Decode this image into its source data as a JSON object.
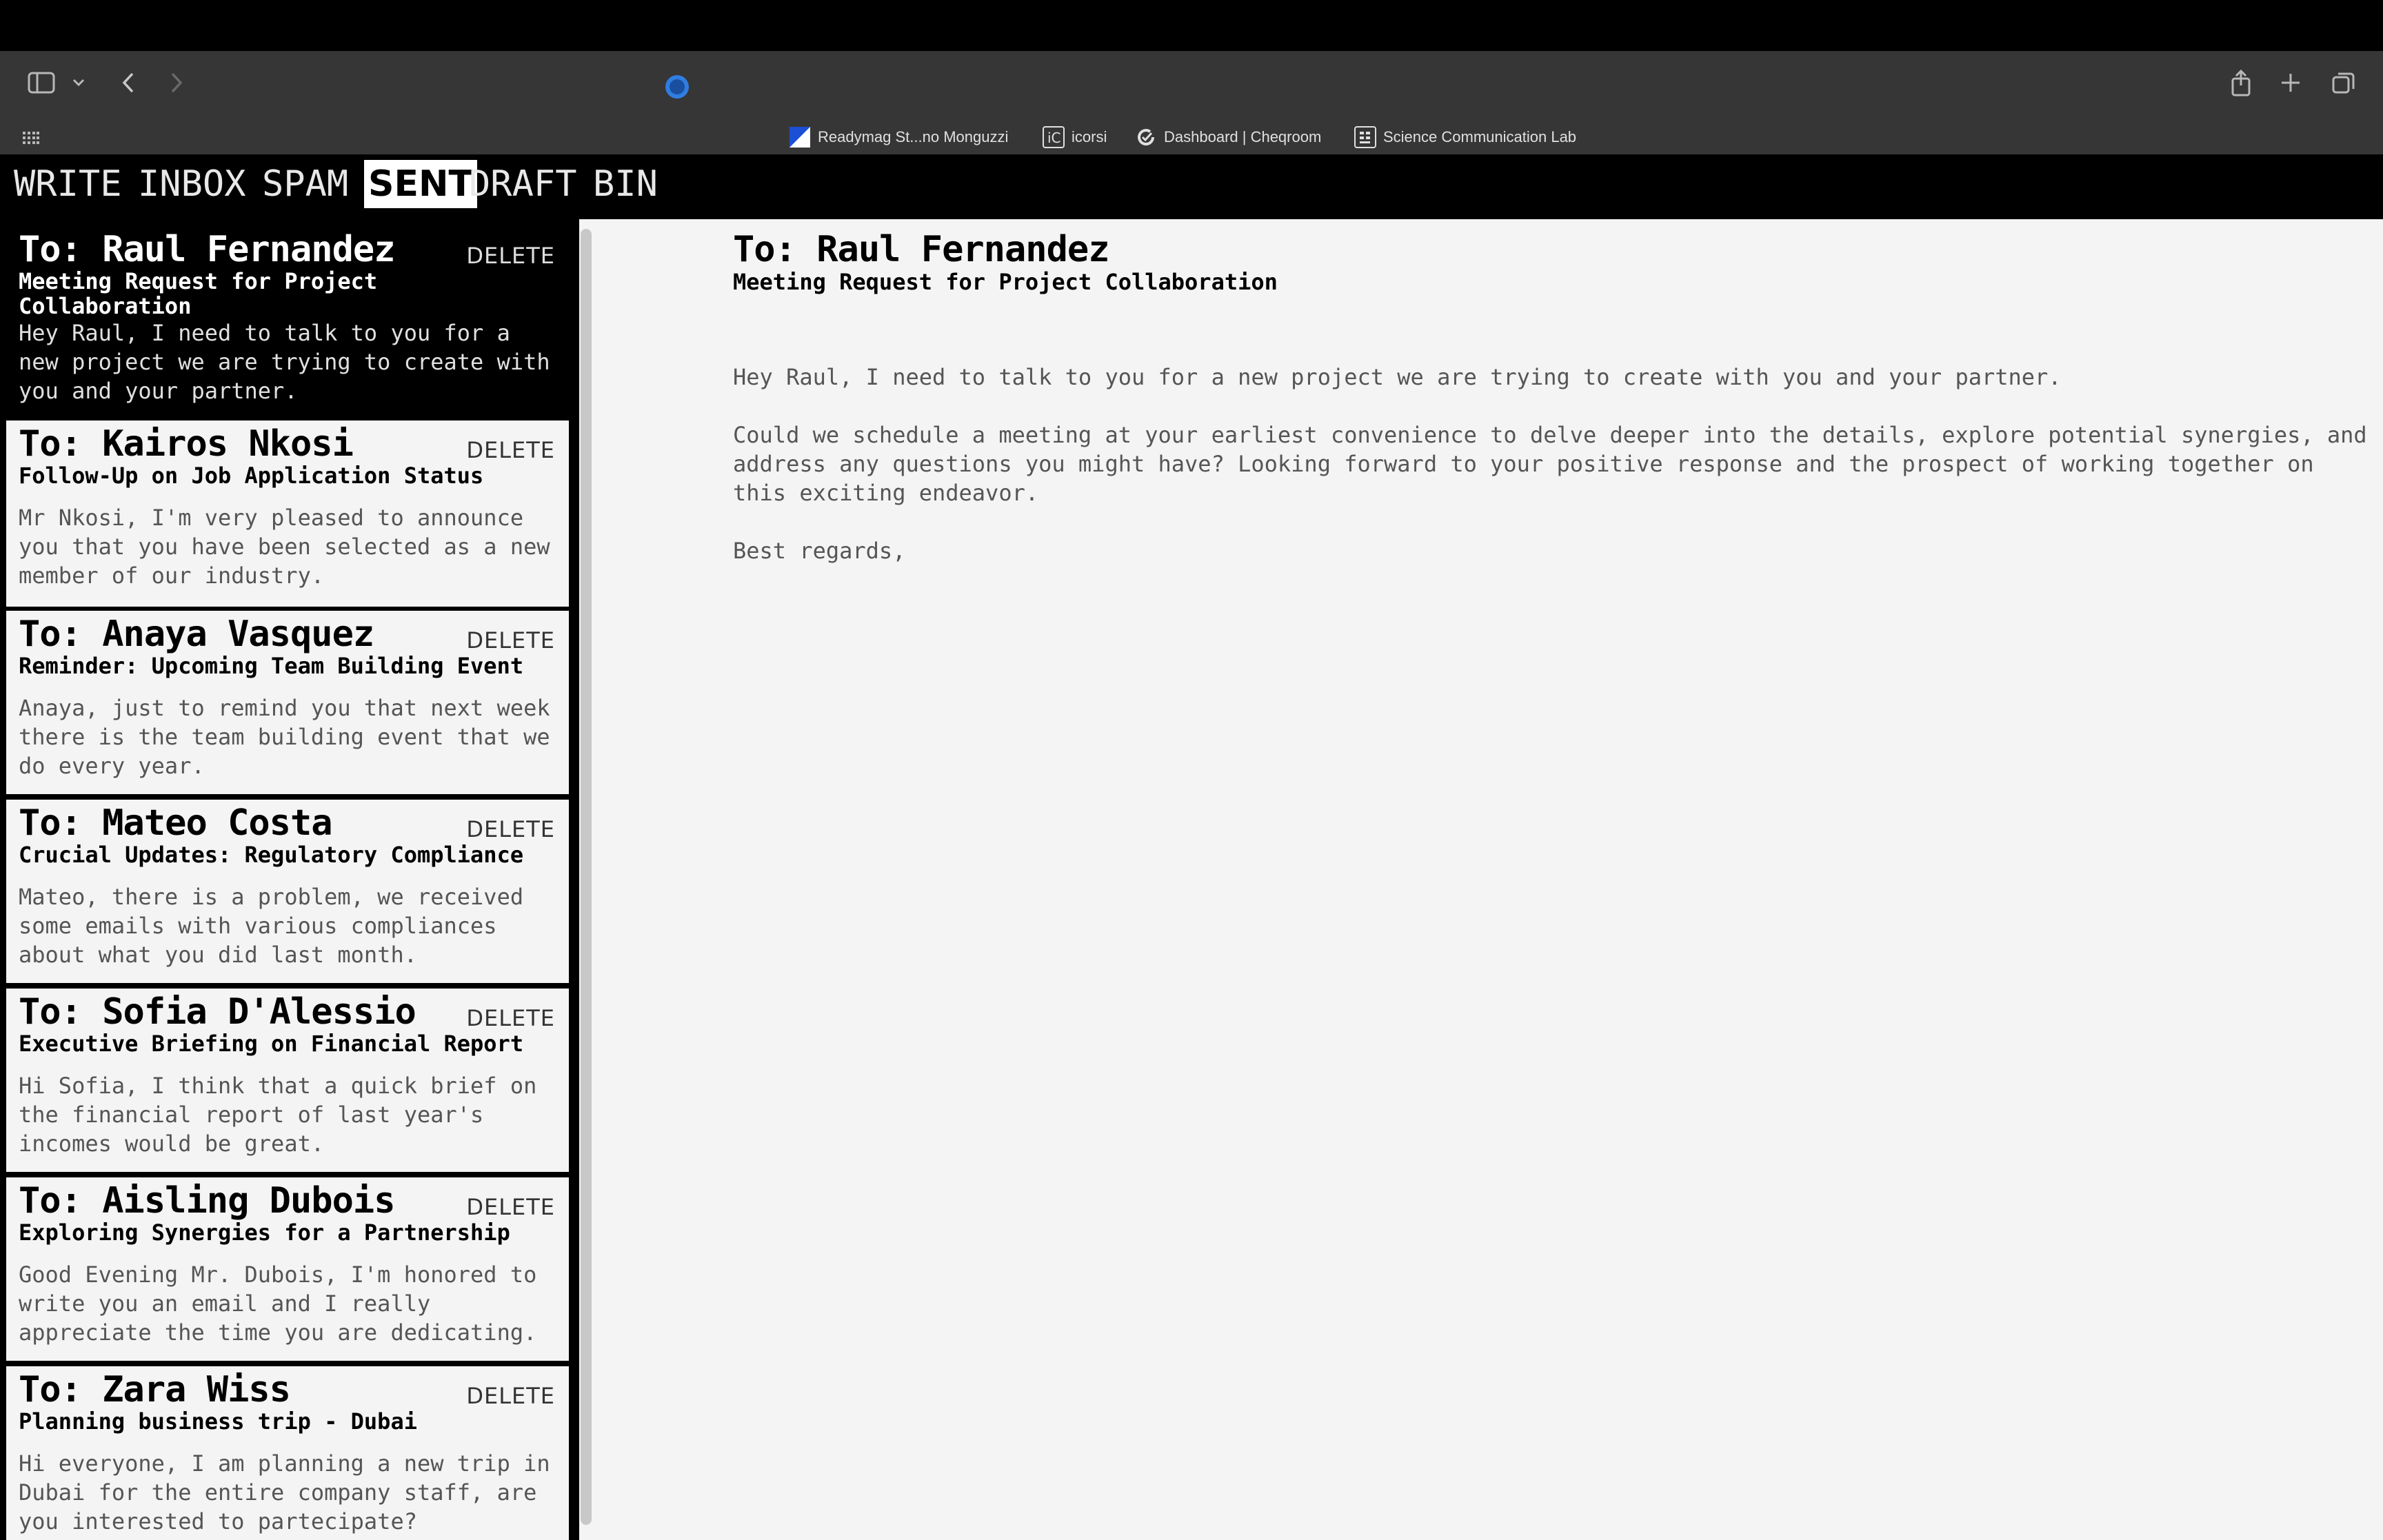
{
  "browser": {
    "url": "localhost",
    "bookmarks": [
      {
        "label": "Readymag St...no Monguzzi",
        "icon": "readymag-favicon"
      },
      {
        "label": "icorsi",
        "icon": "icorsi-favicon"
      },
      {
        "label": "Dashboard | Cheqroom",
        "icon": "cheqroom-favicon"
      },
      {
        "label": "Science Communication Lab",
        "icon": "scl-favicon"
      }
    ]
  },
  "nav": {
    "write": "WRITE",
    "inbox": "INBOX",
    "spam": "SPAM",
    "sent": "SENT",
    "draft": "DRAFT",
    "bin": "BIN",
    "active": "SENT"
  },
  "emails": [
    {
      "to": "To: Raul Fernandez",
      "subject": "Meeting Request for Project Collaboration",
      "preview": "Hey Raul, I need to talk to you for a new project we are trying to create with you and your partner.",
      "delete_label": "DELETE",
      "selected": true
    },
    {
      "to": "To: Kairos Nkosi",
      "subject": "Follow-Up on Job Application Status",
      "preview": "Mr Nkosi, I'm very pleased to announce you that you have been selected as a new member of our industry.",
      "delete_label": "DELETE"
    },
    {
      "to": "To: Anaya Vasquez",
      "subject": "Reminder: Upcoming Team Building Event",
      "preview": "Anaya, just to remind you that next week there is the team building event that we do every year.",
      "delete_label": "DELETE"
    },
    {
      "to": "To: Mateo Costa",
      "subject": "Crucial Updates: Regulatory Compliance",
      "preview": "Mateo, there is a problem, we received some emails with various compliances about what you did last month.",
      "delete_label": "DELETE"
    },
    {
      "to": "To: Sofia D'Alessio",
      "subject": "Executive Briefing on Financial Report",
      "preview": "Hi Sofia, I think that a quick brief on the financial report of last year's incomes would be great.",
      "delete_label": "DELETE"
    },
    {
      "to": "To: Aisling Dubois",
      "subject": "Exploring Synergies for a Partnership",
      "preview": "Good Evening Mr. Dubois, I'm honored to write you an email and I really appreciate the time you are dedicating.",
      "delete_label": "DELETE"
    },
    {
      "to": "To: Zara Wiss",
      "subject": "Planning business trip - Dubai",
      "preview": "Hi everyone, I am planning a new trip in Dubai for the entire company staff, are you interested to partecipate?",
      "delete_label": "DELETE"
    }
  ],
  "reader": {
    "to": "To: Raul Fernandez",
    "subject": "Meeting Request for Project Collaboration",
    "paragraph_1": "Hey Raul, I need to talk to you for a new project we are trying to create with you and your partner.",
    "paragraph_2": "Could we schedule a meeting at your earliest convenience to delve deeper into the details, explore potential synergies, and address any questions you might have? Looking forward to your positive response and the prospect of working together on this exciting endeavor.",
    "closing": "Best regards,"
  },
  "colors": {
    "chrome_bg": "#363636",
    "app_bg": "#f4f4f4",
    "nav_bg": "#000000",
    "selected_card_bg": "#000000",
    "browser_accent": "#2f7de1"
  }
}
